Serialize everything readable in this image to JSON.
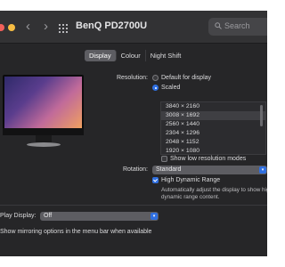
{
  "window": {
    "title": "BenQ PD2700U"
  },
  "search": {
    "placeholder": "Search"
  },
  "tabs": [
    {
      "label": "Display"
    },
    {
      "label": "Colour"
    },
    {
      "label": "Night Shift"
    }
  ],
  "resolution": {
    "label": "Resolution:",
    "options": [
      {
        "label": "Default for display"
      },
      {
        "label": "Scaled"
      }
    ],
    "list": [
      "3840 × 2160",
      "3008 × 1692",
      "2560 × 1440",
      "2304 × 1296",
      "2048 × 1152",
      "1920 × 1080"
    ],
    "show_low_res_label": "Show low resolution modes"
  },
  "rotation": {
    "label": "Rotation:",
    "value": "Standard"
  },
  "hdr": {
    "label": "High Dynamic Range",
    "description_line1": "Automatically adjust the display to show hig",
    "description_line2": "dynamic range content."
  },
  "airplay": {
    "label": "Play Display:",
    "value": "Off"
  },
  "mirroring": {
    "label": "Show mirroring options in the menu bar when available"
  },
  "colors": {
    "accent": "#2f6fe0",
    "background": "#262628"
  }
}
